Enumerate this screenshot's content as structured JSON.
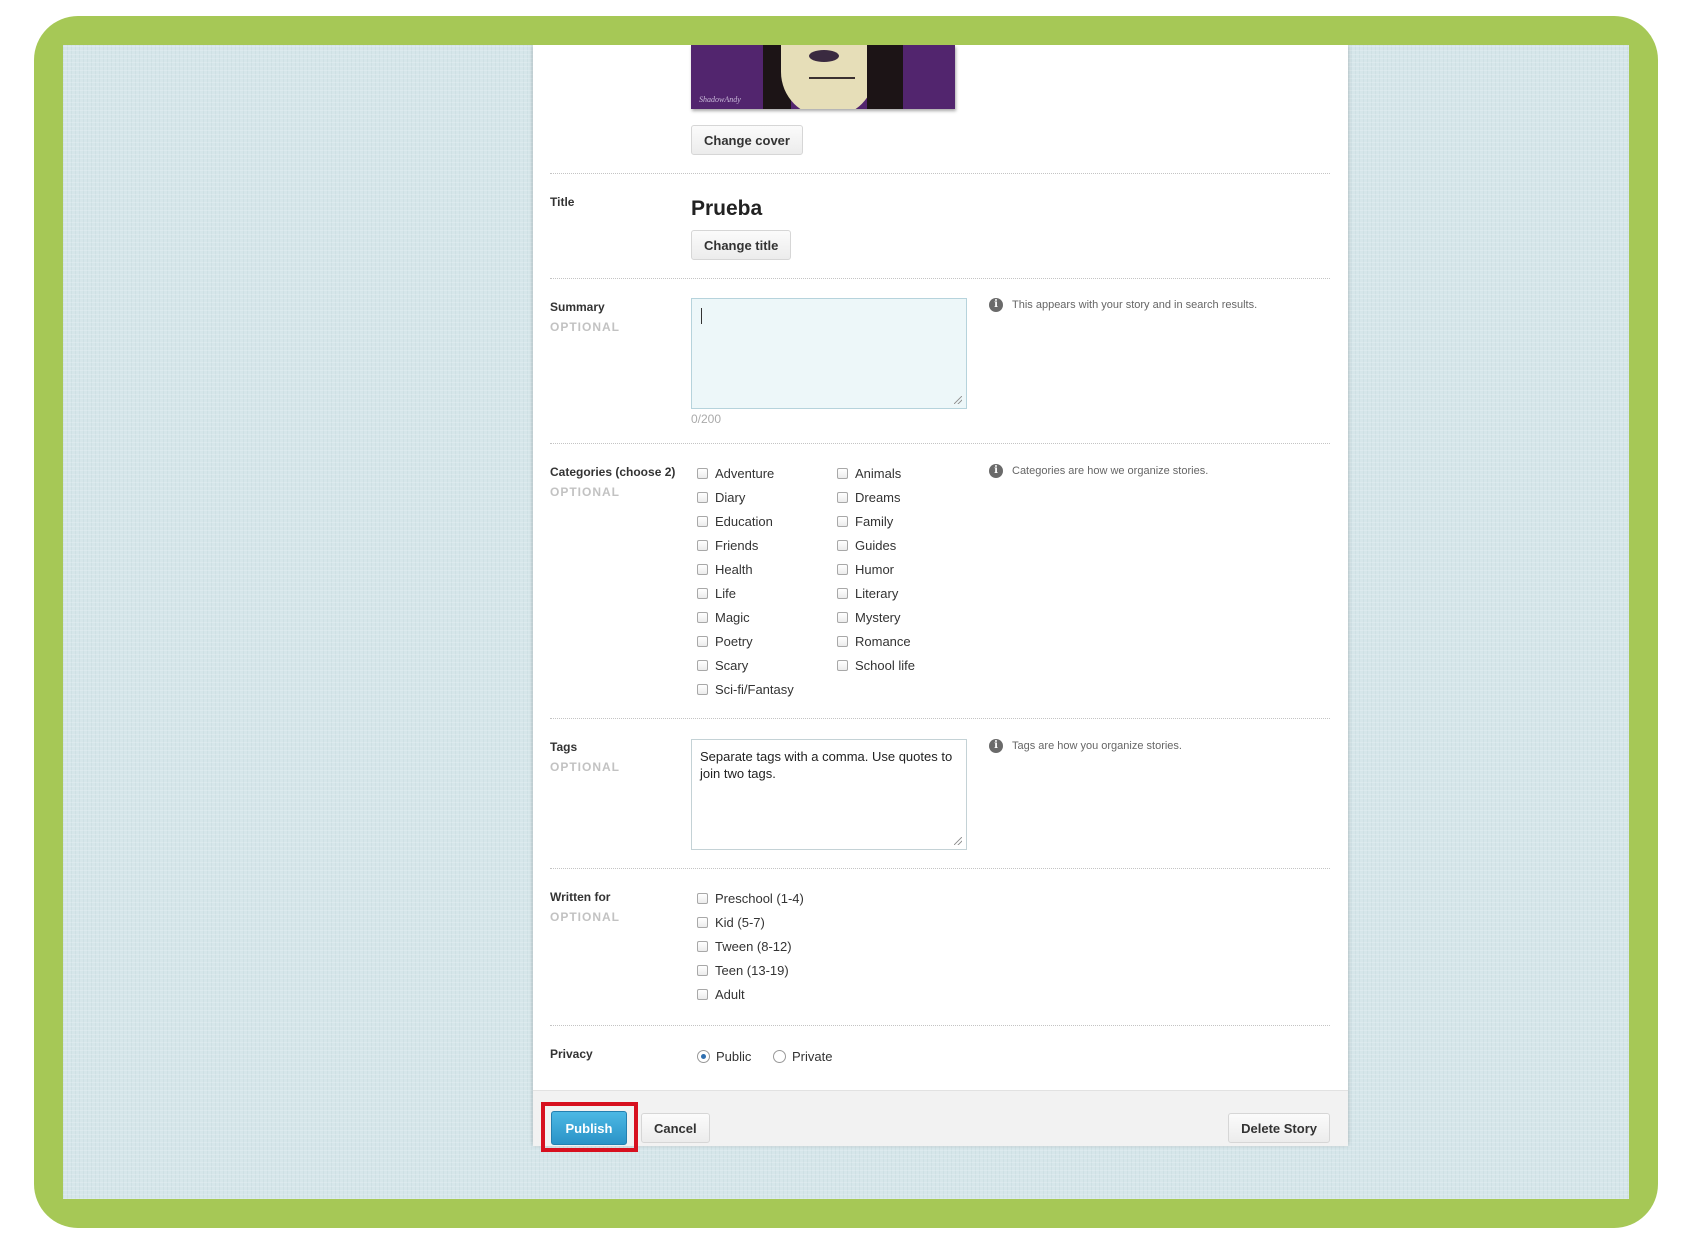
{
  "cover": {
    "signature": "ShadowAndy",
    "change_label": "Change cover"
  },
  "title": {
    "label": "Title",
    "value": "Prueba",
    "change_label": "Change title"
  },
  "summary": {
    "label": "Summary",
    "optional": "OPTIONAL",
    "value": "",
    "counter": "0/200",
    "info": "This appears with your story and in search results."
  },
  "categories": {
    "label": "Categories (choose 2)",
    "optional": "OPTIONAL",
    "info": "Categories are how we organize stories.",
    "column1": [
      "Adventure",
      "Diary",
      "Education",
      "Friends",
      "Health",
      "Life",
      "Magic",
      "Poetry",
      "Scary",
      "Sci-fi/Fantasy"
    ],
    "column2": [
      "Animals",
      "Dreams",
      "Family",
      "Guides",
      "Humor",
      "Literary",
      "Mystery",
      "Romance",
      "School life"
    ]
  },
  "tags": {
    "label": "Tags",
    "optional": "OPTIONAL",
    "placeholder": "Separate tags with a comma. Use quotes to join two tags.",
    "info": "Tags are how you organize stories."
  },
  "written_for": {
    "label": "Written for",
    "optional": "OPTIONAL",
    "options": [
      "Preschool (1-4)",
      "Kid (5-7)",
      "Tween (8-12)",
      "Teen (13-19)",
      "Adult"
    ]
  },
  "privacy": {
    "label": "Privacy",
    "options": [
      {
        "label": "Public",
        "selected": true
      },
      {
        "label": "Private",
        "selected": false
      }
    ]
  },
  "footer": {
    "publish_label": "Publish",
    "cancel_label": "Cancel",
    "delete_label": "Delete Story"
  },
  "colors": {
    "frame": "#a6c856",
    "background": "#d6e6ea",
    "publish": "#2a93c7",
    "highlight": "#d7101f"
  }
}
